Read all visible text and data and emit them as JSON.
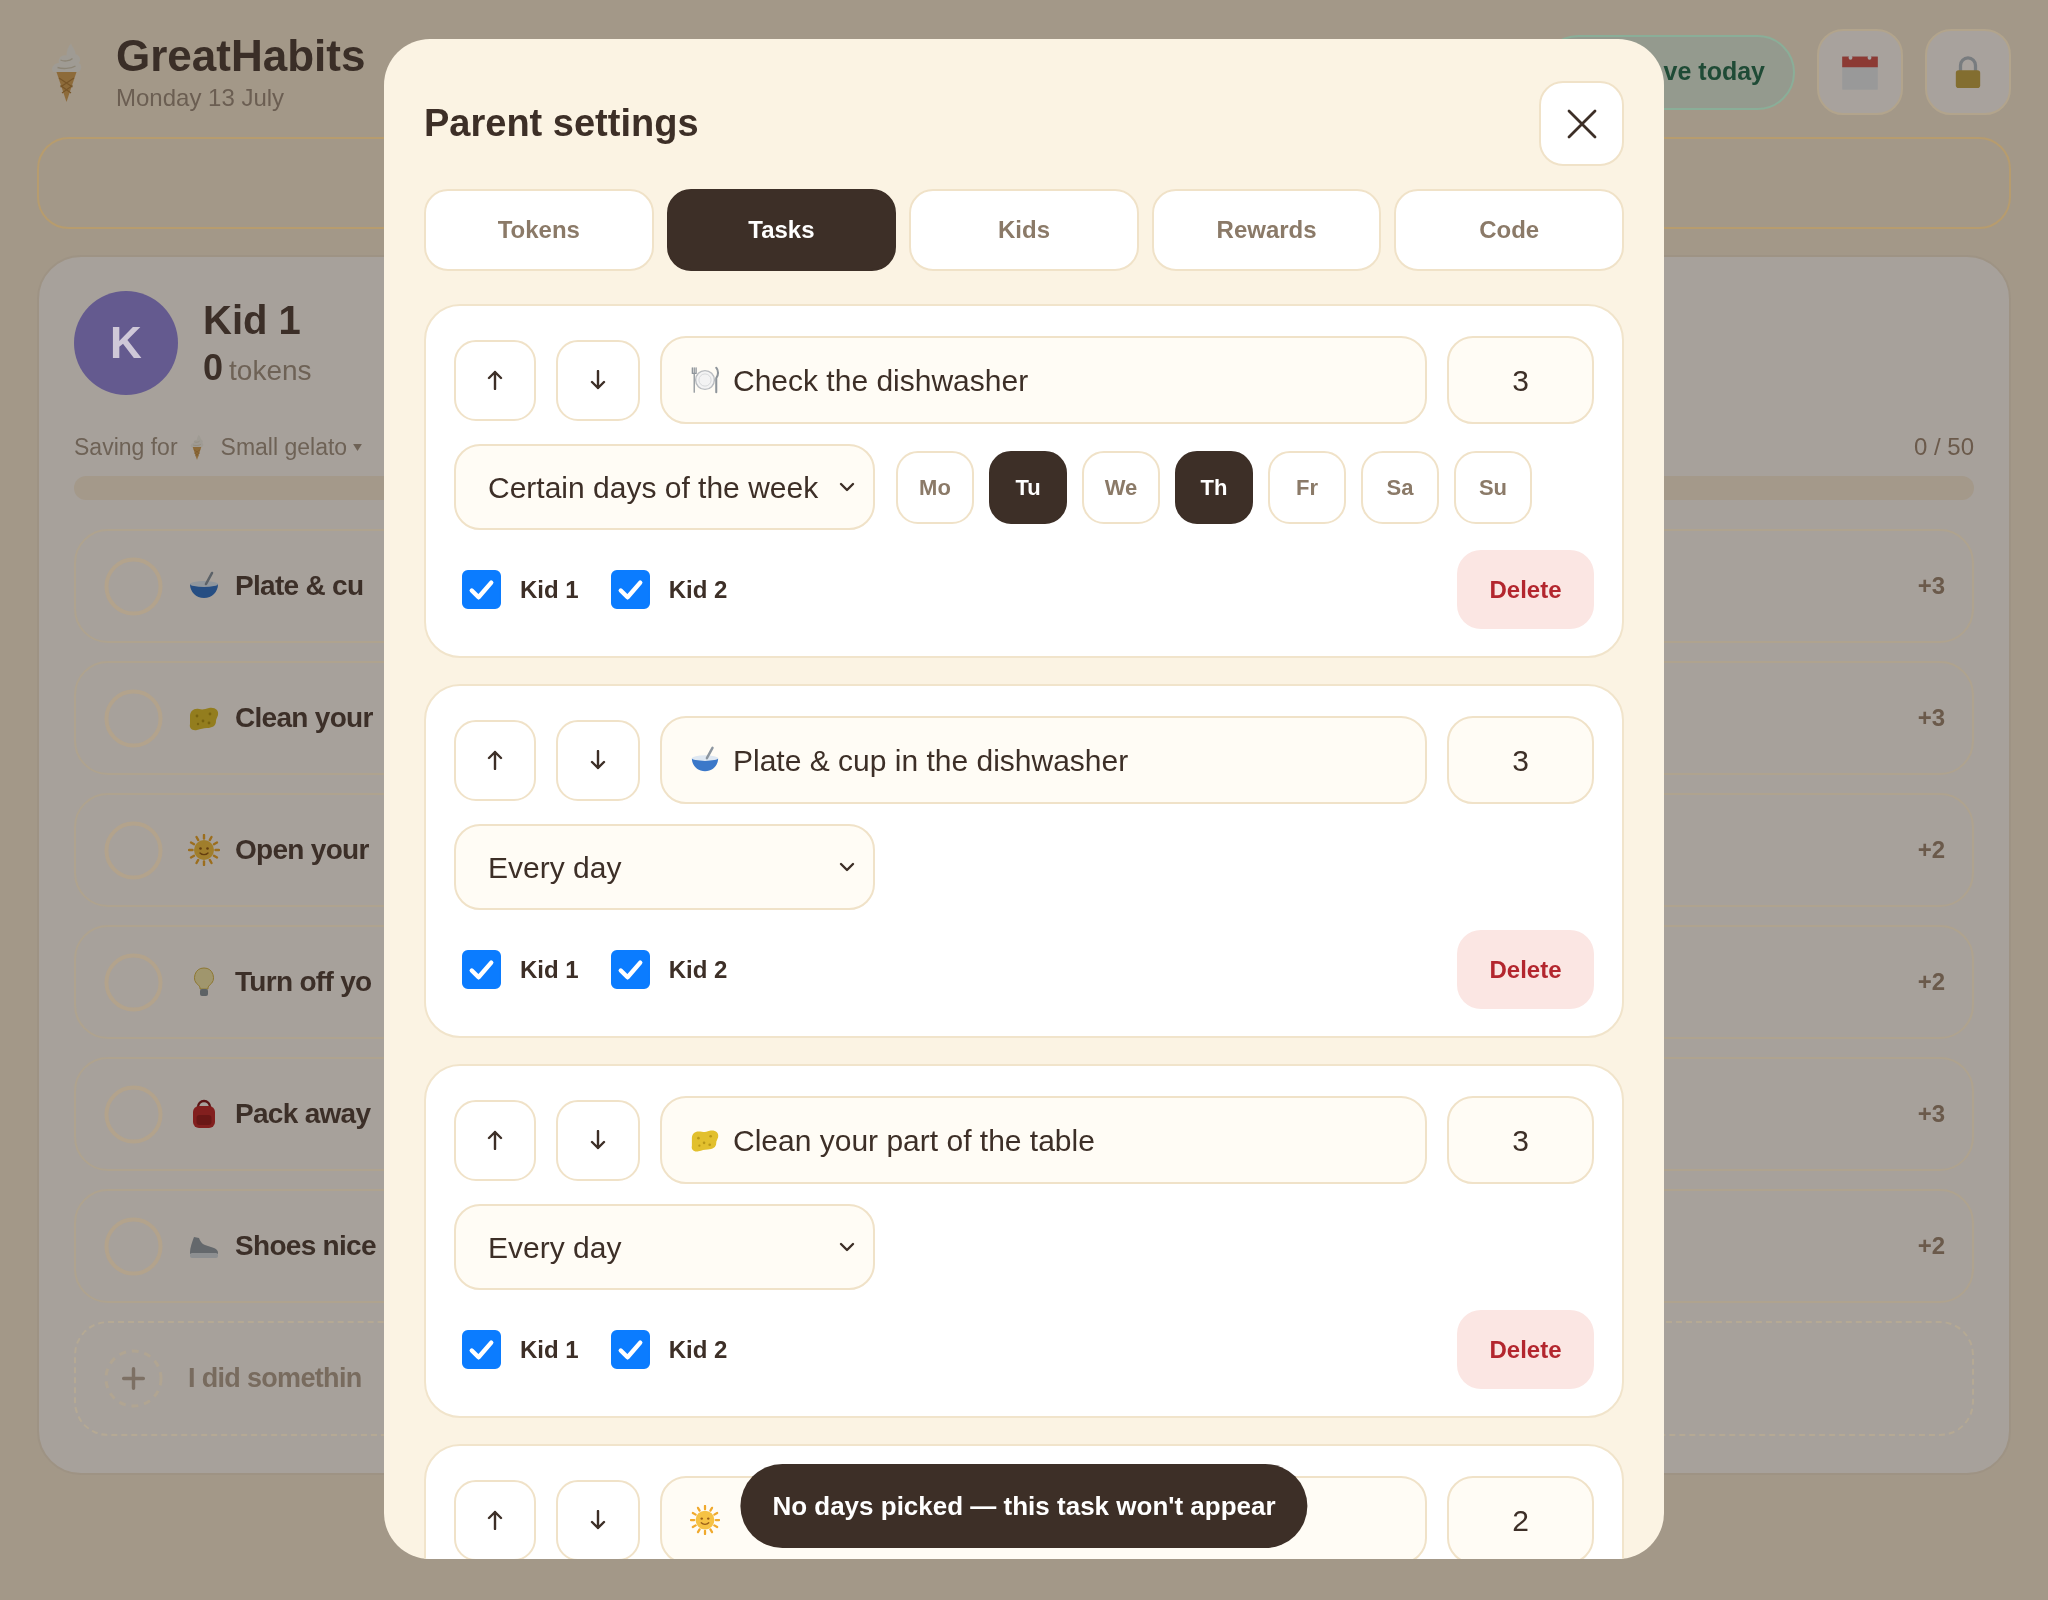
{
  "header": {
    "title": "GreatHabits",
    "date": "Monday 13 July",
    "today_button": "ve today"
  },
  "kid_card": {
    "avatar": "K",
    "name": "Kid 1",
    "token_count": "0",
    "token_label": "tokens",
    "saving_label": "Saving for",
    "saving_goal": "Small gelato",
    "progress_text": "0 / 50",
    "tasks": [
      {
        "kind": "bowl",
        "label": "Plate & cu",
        "points": "+3",
        "done": false
      },
      {
        "kind": "sponge",
        "label": "Clean your",
        "points": "+3",
        "done": false
      },
      {
        "kind": "sun",
        "label": "Open your",
        "points": "+2",
        "done": false
      },
      {
        "kind": "bulb",
        "label": "Turn off yo",
        "points": "+2",
        "done": false
      },
      {
        "kind": "backpack",
        "label": "Pack away",
        "points": "+3",
        "done": false
      },
      {
        "kind": "shoe",
        "label": "Shoes nice",
        "points": "+2",
        "done": false
      }
    ],
    "add_task": "I did somethin"
  },
  "dialog": {
    "title": "Parent settings",
    "tabs": [
      {
        "label": "Tokens",
        "selected": false
      },
      {
        "label": "Tasks",
        "selected": true
      },
      {
        "label": "Kids",
        "selected": false
      },
      {
        "label": "Rewards",
        "selected": false
      },
      {
        "label": "Code",
        "selected": false
      }
    ],
    "tasks": [
      {
        "kind": "plate",
        "name": "Check the dishwasher",
        "points": "3",
        "schedule": "Certain days of the week",
        "days": [
          {
            "label": "Mo",
            "selected": false
          },
          {
            "label": "Tu",
            "selected": true
          },
          {
            "label": "We",
            "selected": false
          },
          {
            "label": "Th",
            "selected": true
          },
          {
            "label": "Fr",
            "selected": false
          },
          {
            "label": "Sa",
            "selected": false
          },
          {
            "label": "Su",
            "selected": false
          }
        ],
        "kids": [
          {
            "label": "Kid 1",
            "checked": true
          },
          {
            "label": "Kid 2",
            "checked": true
          }
        ],
        "delete": "Delete"
      },
      {
        "kind": "bowl",
        "name": "Plate & cup in the dishwasher",
        "points": "3",
        "schedule": "Every day",
        "kids": [
          {
            "label": "Kid 1",
            "checked": true
          },
          {
            "label": "Kid 2",
            "checked": true
          }
        ],
        "delete": "Delete"
      },
      {
        "kind": "sponge",
        "name": "Clean your part of the table",
        "points": "3",
        "schedule": "Every day",
        "kids": [
          {
            "label": "Kid 1",
            "checked": true
          },
          {
            "label": "Kid 2",
            "checked": true
          }
        ],
        "delete": "Delete"
      },
      {
        "kind": "sun",
        "points": "2"
      }
    ],
    "toast": "No days picked — this task won't appear"
  }
}
